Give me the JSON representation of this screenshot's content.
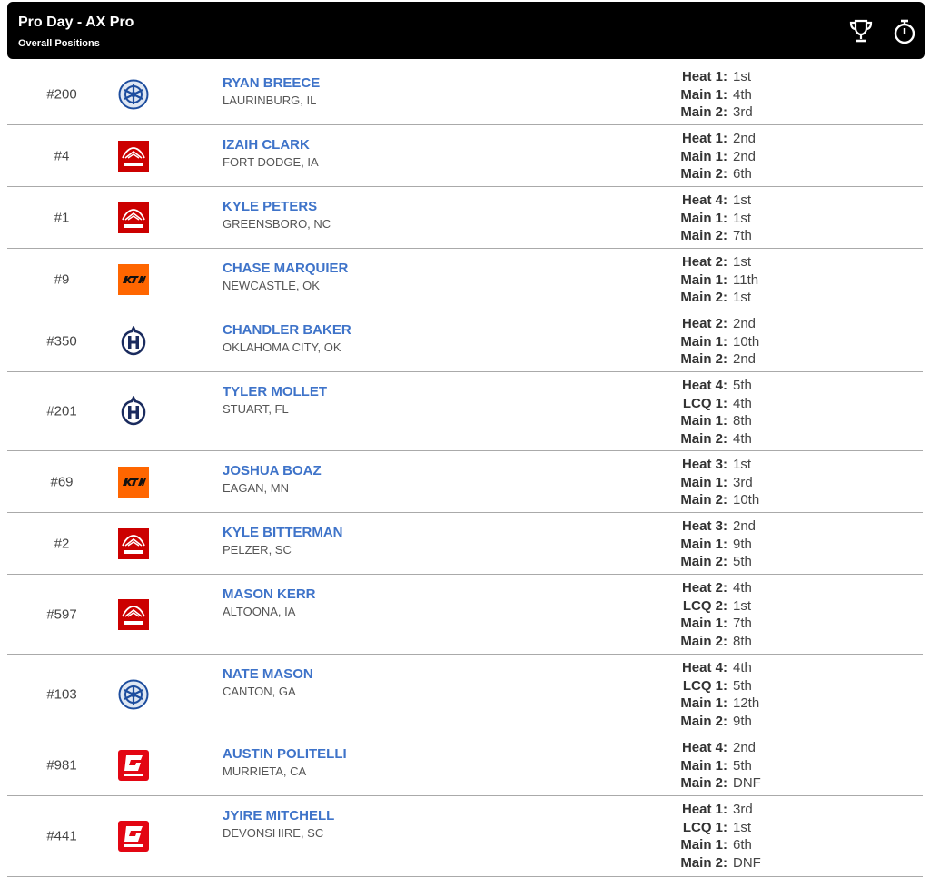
{
  "header": {
    "title": "Pro Day - AX Pro",
    "subtitle": "Overall Positions",
    "icons": [
      "trophy-icon",
      "stopwatch-icon"
    ]
  },
  "colors": {
    "link": "#3e73c9",
    "header_bg": "#000000",
    "honda": "#cc0000",
    "ktm": "#ff6600",
    "husqvarna": "#1a2b5e",
    "yamaha": "#1d4d9e",
    "gasgas": "#e30613"
  },
  "riders": [
    {
      "number": "#200",
      "brand": "yamaha",
      "name": "RYAN BREECE",
      "location": "LAURINBURG, IL",
      "results": [
        {
          "label": "Heat 1:",
          "value": "1st"
        },
        {
          "label": "Main 1:",
          "value": "4th"
        },
        {
          "label": "Main 2:",
          "value": "3rd"
        }
      ]
    },
    {
      "number": "#4",
      "brand": "honda",
      "name": "IZAIH CLARK",
      "location": "FORT DODGE, IA",
      "results": [
        {
          "label": "Heat 1:",
          "value": "2nd"
        },
        {
          "label": "Main 1:",
          "value": "2nd"
        },
        {
          "label": "Main 2:",
          "value": "6th"
        }
      ]
    },
    {
      "number": "#1",
      "brand": "honda",
      "name": "KYLE PETERS",
      "location": "GREENSBORO, NC",
      "results": [
        {
          "label": "Heat 4:",
          "value": "1st"
        },
        {
          "label": "Main 1:",
          "value": "1st"
        },
        {
          "label": "Main 2:",
          "value": "7th"
        }
      ]
    },
    {
      "number": "#9",
      "brand": "ktm",
      "name": "CHASE MARQUIER",
      "location": "NEWCASTLE, OK",
      "results": [
        {
          "label": "Heat 2:",
          "value": "1st"
        },
        {
          "label": "Main 1:",
          "value": "11th"
        },
        {
          "label": "Main 2:",
          "value": "1st"
        }
      ]
    },
    {
      "number": "#350",
      "brand": "husqvarna",
      "name": "CHANDLER BAKER",
      "location": "OKLAHOMA CITY, OK",
      "results": [
        {
          "label": "Heat 2:",
          "value": "2nd"
        },
        {
          "label": "Main 1:",
          "value": "10th"
        },
        {
          "label": "Main 2:",
          "value": "2nd"
        }
      ]
    },
    {
      "number": "#201",
      "brand": "husqvarna",
      "name": "TYLER MOLLET",
      "location": "STUART, FL",
      "results": [
        {
          "label": "Heat 4:",
          "value": "5th"
        },
        {
          "label": "LCQ 1:",
          "value": "4th"
        },
        {
          "label": "Main 1:",
          "value": "8th"
        },
        {
          "label": "Main 2:",
          "value": "4th"
        }
      ]
    },
    {
      "number": "#69",
      "brand": "ktm",
      "name": "JOSHUA BOAZ",
      "location": "EAGAN, MN",
      "results": [
        {
          "label": "Heat 3:",
          "value": "1st"
        },
        {
          "label": "Main 1:",
          "value": "3rd"
        },
        {
          "label": "Main 2:",
          "value": "10th"
        }
      ]
    },
    {
      "number": "#2",
      "brand": "honda",
      "name": "KYLE BITTERMAN",
      "location": "PELZER, SC",
      "results": [
        {
          "label": "Heat 3:",
          "value": "2nd"
        },
        {
          "label": "Main 1:",
          "value": "9th"
        },
        {
          "label": "Main 2:",
          "value": "5th"
        }
      ]
    },
    {
      "number": "#597",
      "brand": "honda",
      "name": "MASON KERR",
      "location": "ALTOONA, IA",
      "results": [
        {
          "label": "Heat 2:",
          "value": "4th"
        },
        {
          "label": "LCQ 2:",
          "value": "1st"
        },
        {
          "label": "Main 1:",
          "value": "7th"
        },
        {
          "label": "Main 2:",
          "value": "8th"
        }
      ]
    },
    {
      "number": "#103",
      "brand": "yamaha",
      "name": "NATE MASON",
      "location": "CANTON, GA",
      "results": [
        {
          "label": "Heat 4:",
          "value": "4th"
        },
        {
          "label": "LCQ 1:",
          "value": "5th"
        },
        {
          "label": "Main 1:",
          "value": "12th"
        },
        {
          "label": "Main 2:",
          "value": "9th"
        }
      ]
    },
    {
      "number": "#981",
      "brand": "gasgas",
      "name": "AUSTIN POLITELLI",
      "location": "MURRIETA, CA",
      "results": [
        {
          "label": "Heat 4:",
          "value": "2nd"
        },
        {
          "label": "Main 1:",
          "value": "5th"
        },
        {
          "label": "Main 2:",
          "value": "DNF"
        }
      ]
    },
    {
      "number": "#441",
      "brand": "gasgas",
      "name": "JYIRE MITCHELL",
      "location": "DEVONSHIRE, SC",
      "results": [
        {
          "label": "Heat 1:",
          "value": "3rd"
        },
        {
          "label": "LCQ 1:",
          "value": "1st"
        },
        {
          "label": "Main 1:",
          "value": "6th"
        },
        {
          "label": "Main 2:",
          "value": "DNF"
        }
      ]
    }
  ]
}
